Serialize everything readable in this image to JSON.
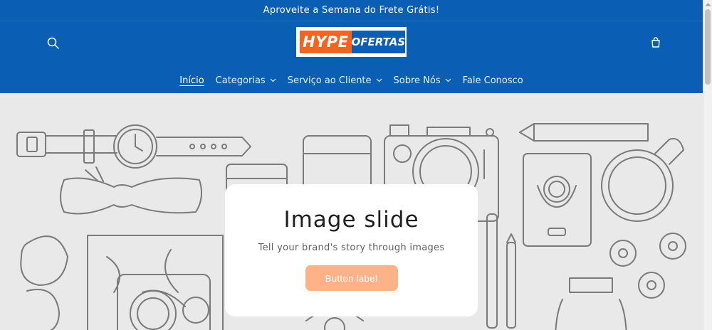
{
  "announcement": {
    "text": "Aproveite a Semana do Frete Grátis!"
  },
  "header": {
    "logo": {
      "part1": "HYPE",
      "part2": "OFERTAS"
    },
    "search_icon": "search-icon",
    "cart_icon": "cart-icon"
  },
  "nav": {
    "items": [
      {
        "label": "Início",
        "active": true,
        "dropdown": false
      },
      {
        "label": "Categorias",
        "active": false,
        "dropdown": true
      },
      {
        "label": "Serviço ao Cliente",
        "active": false,
        "dropdown": true
      },
      {
        "label": "Sobre Nós",
        "active": false,
        "dropdown": true
      },
      {
        "label": "Fale Conosco",
        "active": false,
        "dropdown": false
      }
    ]
  },
  "slide": {
    "title": "Image slide",
    "subtitle": "Tell your brand's story through images",
    "button_label": "Button label"
  },
  "colors": {
    "brand_blue": "#0a5fb5",
    "logo_orange": "#f2641f",
    "button_peach": "#fdb288",
    "hero_bg": "#e9e9e9"
  }
}
